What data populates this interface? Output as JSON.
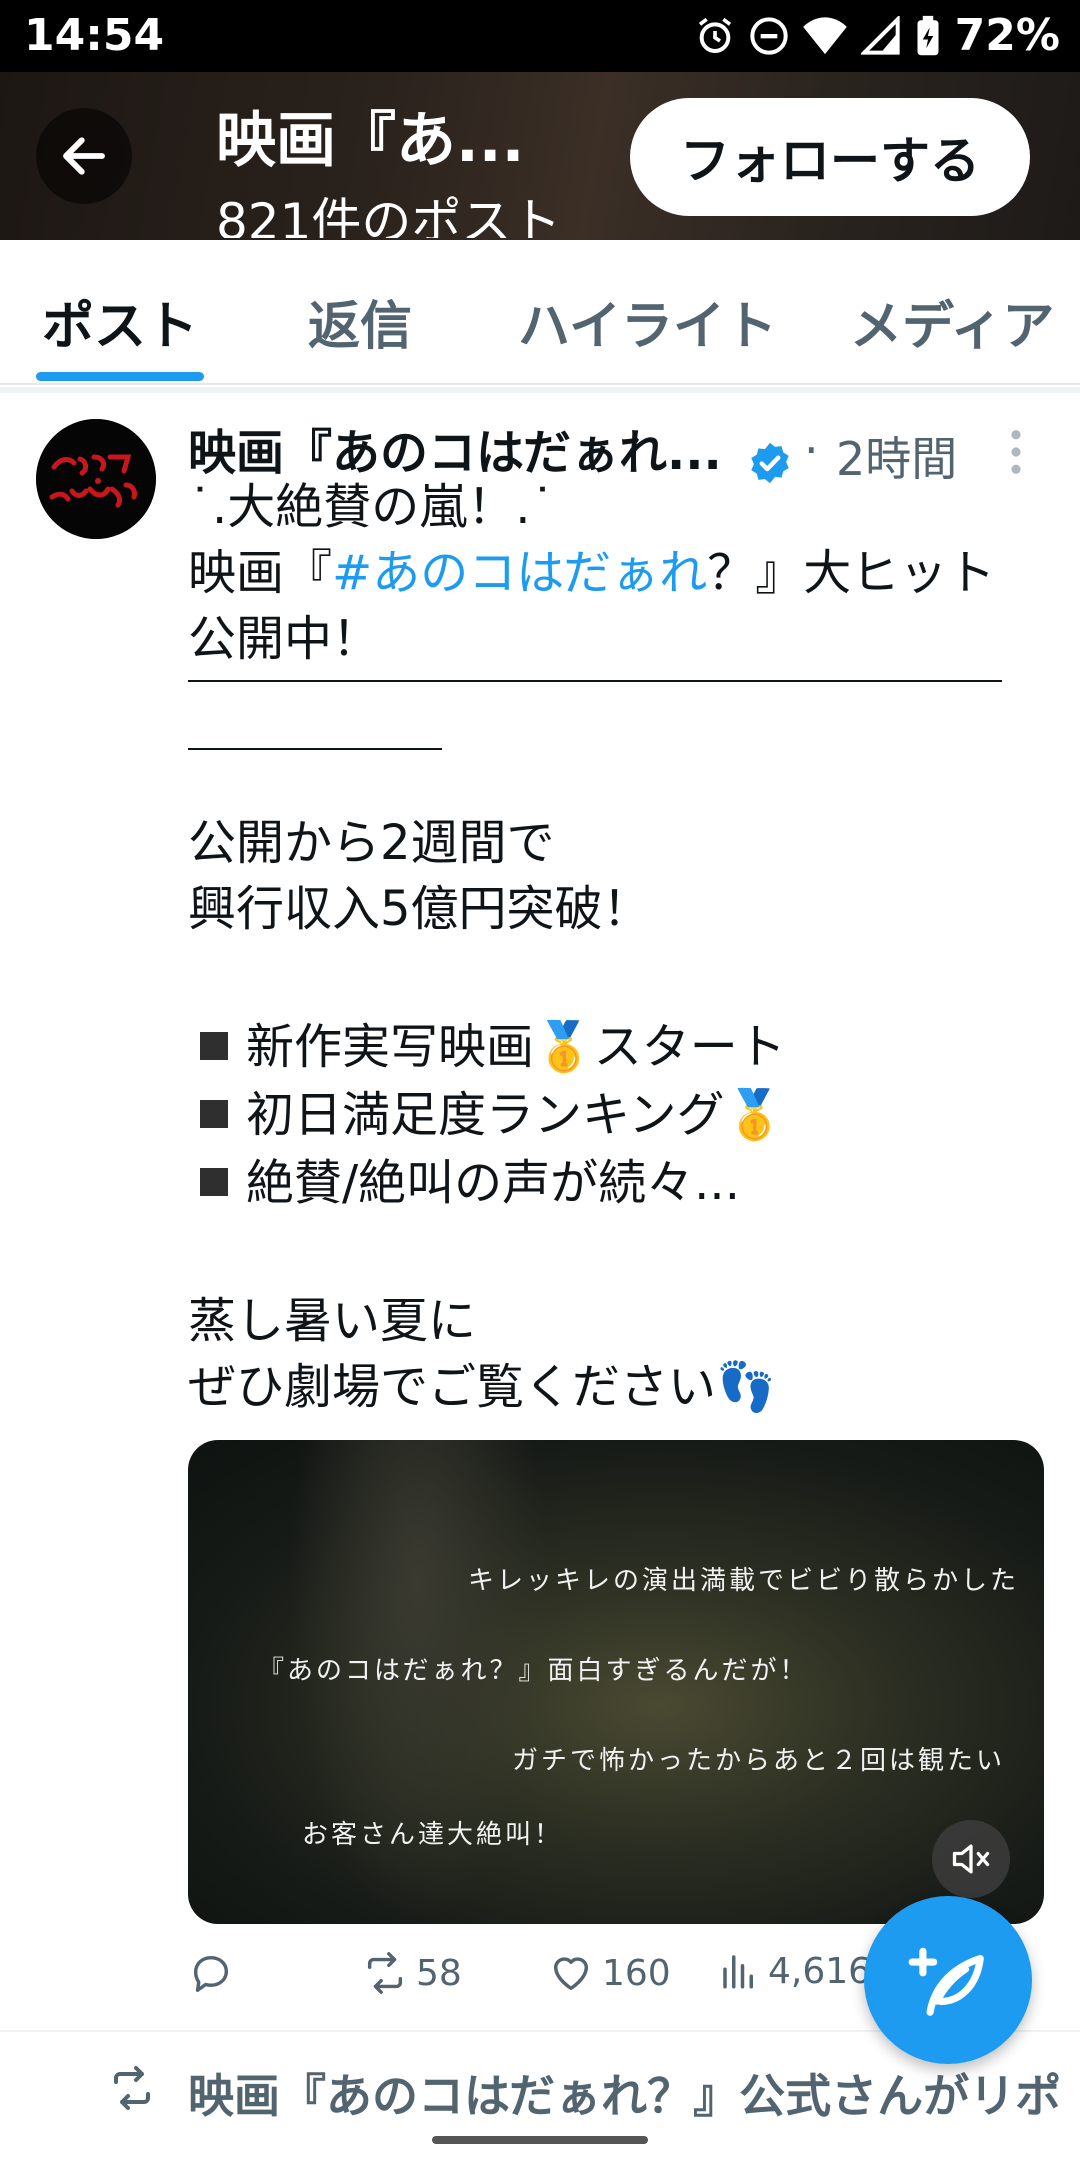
{
  "status_bar": {
    "time": "14:54",
    "battery": "72%"
  },
  "header": {
    "title": "映画『あ...",
    "subtitle": "821件のポスト",
    "follow_label": "フォローする"
  },
  "tabs": [
    "ポスト",
    "返信",
    "ハイライト",
    "メディア"
  ],
  "post": {
    "author": "映画『あのコはだぁれ...",
    "separator": "·",
    "time": "2時間",
    "lines": {
      "l1": "˙.大絶賛の嵐！.˙",
      "l2_pre": "映画『",
      "l2_tag": "#あのコはだぁれ",
      "l2_post": "？』大ヒット",
      "l3": "公開中！",
      "l4": "公開から2週間で",
      "l5": "興行収入5億円突破！",
      "b1": "新作実写映画🥇スタート",
      "b2": "初日満足度ランキング🥇",
      "b3": "絶賛/絶叫の声が続々...",
      "l6": "蒸し暑い夏に",
      "l7": "ぜひ劇場でご覧ください👣"
    },
    "media_captions": {
      "c1": "キレッキレの演出満載でビビり散らかした",
      "c2": "『あのコはだぁれ？』面白すぎるんだが！",
      "c3": "ガチで怖かったからあと２回は観たい",
      "c4": "お客さん達大絶叫！"
    },
    "reposts": "58",
    "likes": "160",
    "views": "4,616"
  },
  "repost_notice": "映画『あのコはだぁれ？』公式さんがリポ",
  "colors": {
    "accent": "#1d9bf0",
    "text": "#0f1419",
    "muted": "#536471"
  }
}
